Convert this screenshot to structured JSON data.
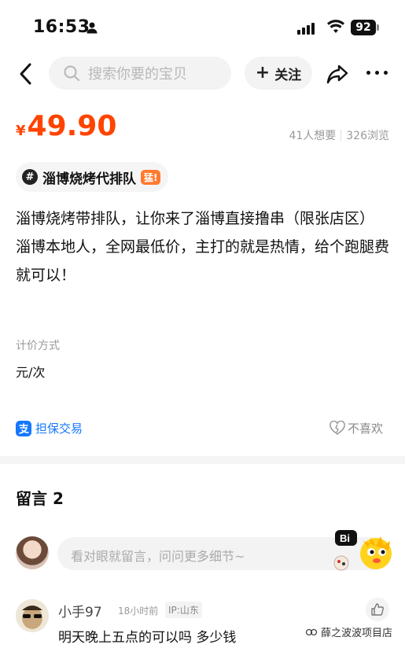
{
  "status_bar": {
    "time": "16:53",
    "battery": "92"
  },
  "nav": {
    "search_placeholder": "搜索你要的宝贝",
    "follow_label": "关注",
    "follow_plus": "+"
  },
  "product": {
    "currency": "¥",
    "price": "49.90",
    "wants": "41人想要",
    "views": "326浏览",
    "tag_hash": "#",
    "tag_text": "淄博烧烤代排队",
    "tag_badge": "猛!",
    "description": [
      "淄博烧烤带排队，让你来了淄博直接撸串（限张店区）",
      "淄博本地人，全网最低价，主打的就是热情，给个跑腿费就可以！"
    ],
    "pricing_label": "计价方式",
    "pricing_unit": "元/次",
    "guarantee": "担保交易",
    "dislike": "不喜欢"
  },
  "comments": {
    "title": "留言 2",
    "input_placeholder": "看对眼就留言，问问更多细节~",
    "mascot_text": "Bi",
    "items": [
      {
        "user": "小手97",
        "time": "18小时前",
        "ip": "IP:山东",
        "text": "明天晚上五点的可以吗  多少钱"
      }
    ]
  },
  "watermark": "薛之波波项目店",
  "colors": {
    "accent": "#ff4400",
    "link": "#1677ff",
    "muted": "#999999"
  }
}
